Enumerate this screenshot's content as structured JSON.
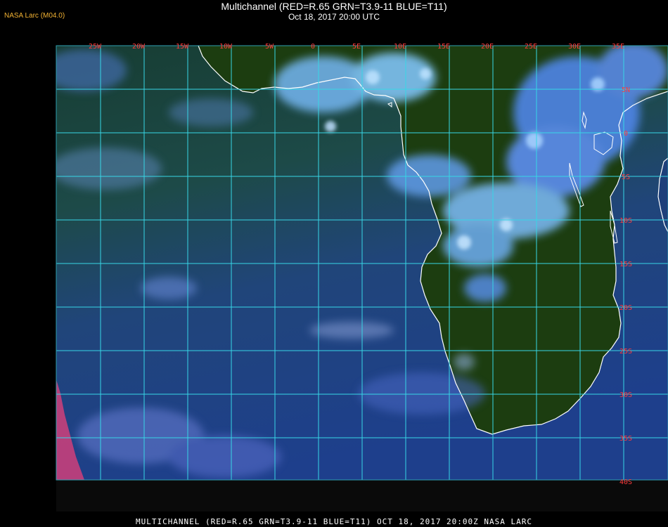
{
  "header": {
    "title": "Multichannel (RED=R.65 GRN=T3.9-11 BLUE=T11)",
    "datetime": "Oct 18, 2017 20:00 UTC",
    "provider_tag": "NASA Larc (M04.0)"
  },
  "footer": {
    "caption": "MULTICHANNEL (RED=R.65 GRN=T3.9-11 BLUE=T11) OCT 18, 2017 20:00Z   NASA LARC"
  },
  "map": {
    "longitude_labels": [
      "25W",
      "20W",
      "15W",
      "10W",
      "5W",
      "0",
      "5E",
      "10E",
      "15E",
      "20E",
      "25E",
      "30E",
      "35E"
    ],
    "latitude_labels": [
      "5N",
      "0",
      "5S",
      "10S",
      "15S",
      "20S",
      "25S",
      "30S",
      "35S",
      "40S"
    ],
    "colors": {
      "grid": "#37d6e6",
      "tick_labels": "#ff3b3b",
      "coastline": "#ffffff",
      "clouds": "#8fd0ff",
      "land": "#1c3d10",
      "ocean": "#1d3f8a"
    }
  }
}
